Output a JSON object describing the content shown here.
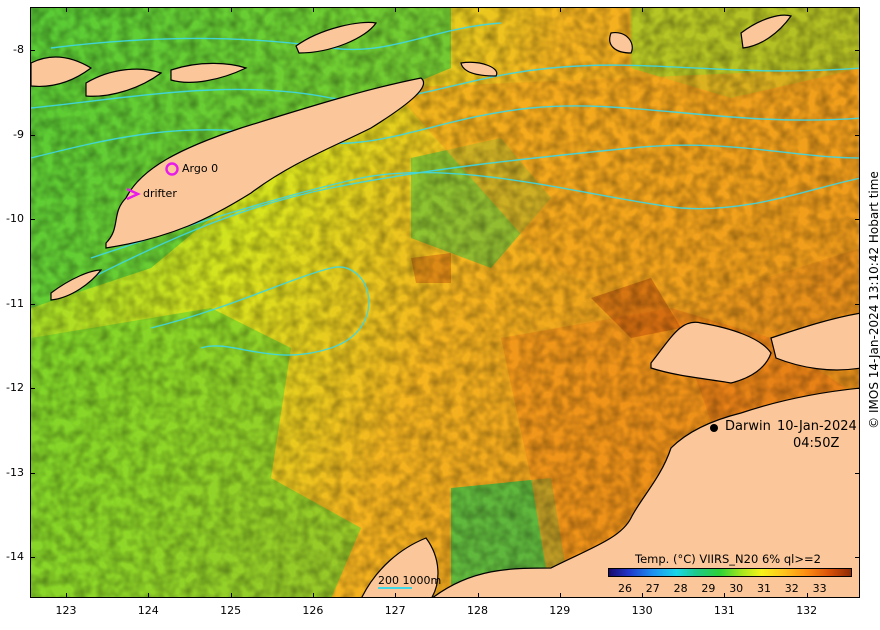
{
  "map": {
    "x_ticks": [
      "123",
      "124",
      "125",
      "126",
      "127",
      "128",
      "129",
      "130",
      "131",
      "132"
    ],
    "y_ticks": [
      "-8",
      "-9",
      "-10",
      "-11",
      "-12",
      "-13",
      "-14"
    ],
    "credit": "© IMOS 14-Jan-2024 13:10:42 Hobart time",
    "timestamp_date": "10-Jan-2024",
    "timestamp_time": "04:50Z",
    "place_label": "Darwin",
    "markers": [
      {
        "label": "Argo 0",
        "symbol": "circle",
        "color": "#e81ce8"
      },
      {
        "label": "drifter",
        "symbol": "chevron",
        "color": "#e81ce8"
      }
    ],
    "colorbar": {
      "title": "Temp. (°C) VIIRS_N20 6% ql>=2",
      "ticks": [
        "26",
        "27",
        "28",
        "29",
        "30",
        "31",
        "32",
        "33"
      ]
    },
    "scalebar_label": "200  1000m",
    "colors": {
      "land": "#fbc79a",
      "contour": "#3ed8e6",
      "sst_warm": "#f7b21e",
      "sst_cool": "#36c63a"
    }
  }
}
